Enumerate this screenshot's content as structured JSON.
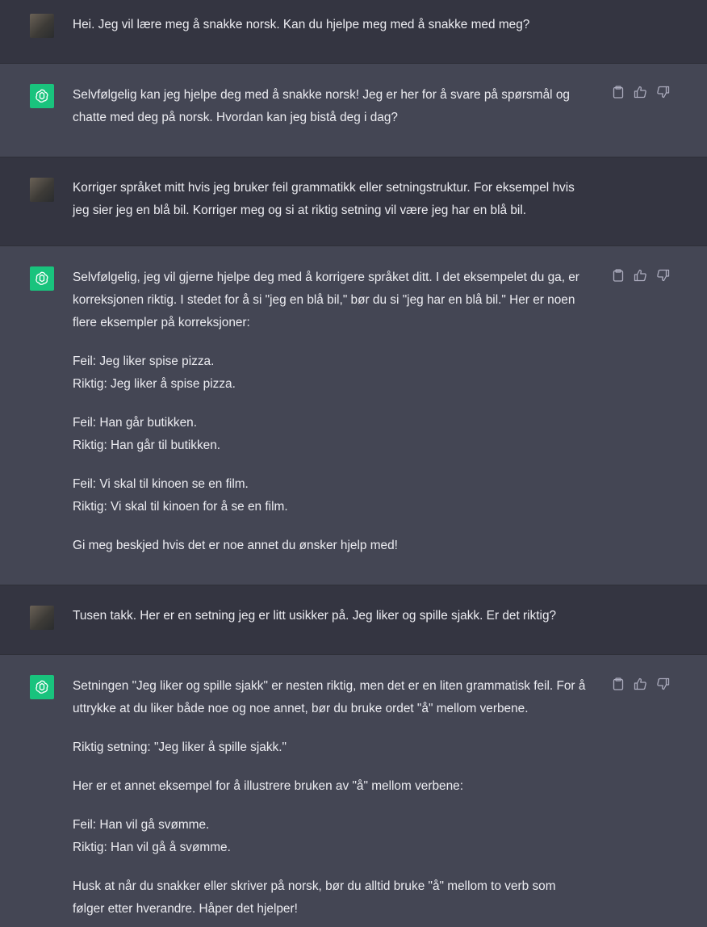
{
  "colors": {
    "user_bg": "#343541",
    "assistant_bg": "#444654",
    "bot_avatar": "#19c37d",
    "text": "#ececf1",
    "icon": "#acacbe"
  },
  "icons": {
    "copy": "clipboard-icon",
    "like": "thumbs-up-icon",
    "dislike": "thumbs-down-icon",
    "bot_avatar": "openai-logo-icon",
    "user_avatar": "user-photo-avatar"
  },
  "messages": [
    {
      "role": "user",
      "paragraphs": [
        [
          "Hei. Jeg vil lære meg å snakke norsk. Kan du hjelpe meg med å snakke med meg?"
        ]
      ]
    },
    {
      "role": "assistant",
      "paragraphs": [
        [
          "Selvfølgelig kan jeg hjelpe deg med å snakke norsk! Jeg er her for å svare på spørsmål og",
          "chatte med deg på norsk. Hvordan kan jeg bistå deg i dag?"
        ]
      ]
    },
    {
      "role": "user",
      "paragraphs": [
        [
          "Korriger språket mitt hvis jeg bruker feil grammatikk eller setningstruktur. For eksempel hvis",
          "jeg sier jeg en blå bil. Korriger meg og si at riktig setning vil være jeg har en blå bil."
        ]
      ]
    },
    {
      "role": "assistant",
      "paragraphs": [
        [
          "Selvfølgelig, jeg vil gjerne hjelpe deg med å korrigere språket ditt. I det eksempelet du ga, er",
          "korreksjonen riktig. I stedet for å si \"jeg en blå bil,\" bør du si \"jeg har en blå bil.\" Her er noen",
          "flere eksempler på korreksjoner:"
        ],
        [
          "Feil: Jeg liker spise pizza.",
          "Riktig: Jeg liker å spise pizza."
        ],
        [
          "Feil: Han går butikken.",
          "Riktig: Han går til butikken."
        ],
        [
          "Feil: Vi skal til kinoen se en film.",
          "Riktig: Vi skal til kinoen for å se en film."
        ],
        [
          "Gi meg beskjed hvis det er noe annet du ønsker hjelp med!"
        ]
      ]
    },
    {
      "role": "user",
      "paragraphs": [
        [
          "Tusen takk. Her er en setning jeg er litt usikker på. Jeg liker og spille sjakk. Er det riktig?"
        ]
      ]
    },
    {
      "role": "assistant",
      "paragraphs": [
        [
          "Setningen \"Jeg liker og spille sjakk\" er nesten riktig, men det er en liten grammatisk feil. For å",
          "uttrykke at du liker både noe og noe annet, bør du bruke ordet \"å\" mellom verbene."
        ],
        [
          "Riktig setning: \"Jeg liker å spille sjakk.\""
        ],
        [
          "Her er et annet eksempel for å illustrere bruken av \"å\" mellom verbene:"
        ],
        [
          "Feil: Han vil gå svømme.",
          "Riktig: Han vil gå å svømme."
        ],
        [
          "Husk at når du snakker eller skriver på norsk, bør du alltid bruke \"å\" mellom to verb som",
          "følger etter hverandre. Håper det hjelper!"
        ]
      ]
    }
  ]
}
